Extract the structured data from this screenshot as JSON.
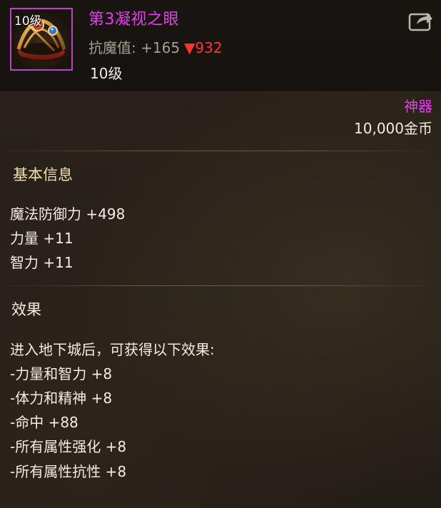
{
  "item": {
    "icon_level": "10级",
    "name": "第3凝视之眼",
    "stat_label": "抗魔值:",
    "stat_value": "+165",
    "stat_diff": "▼932",
    "level": "10级",
    "rarity": "神器",
    "price": "10,000金币"
  },
  "basic": {
    "title": "基本信息",
    "lines": [
      "魔法防御力 +498",
      "力量 +11",
      "智力 +11"
    ]
  },
  "effect": {
    "title": "效果",
    "lines": [
      "进入地下城后，可获得以下效果:",
      "-力量和智力 +8",
      "-体力和精神 +8",
      "-命中 +88",
      "-所有属性强化 +8",
      "-所有属性抗性 +8"
    ]
  },
  "colors": {
    "rarity": "#e040e8",
    "decrease": "#ff3333",
    "section_title": "#f3dfb2"
  },
  "icons": {
    "item": "ring-with-gems-icon",
    "export": "share-export-icon"
  }
}
